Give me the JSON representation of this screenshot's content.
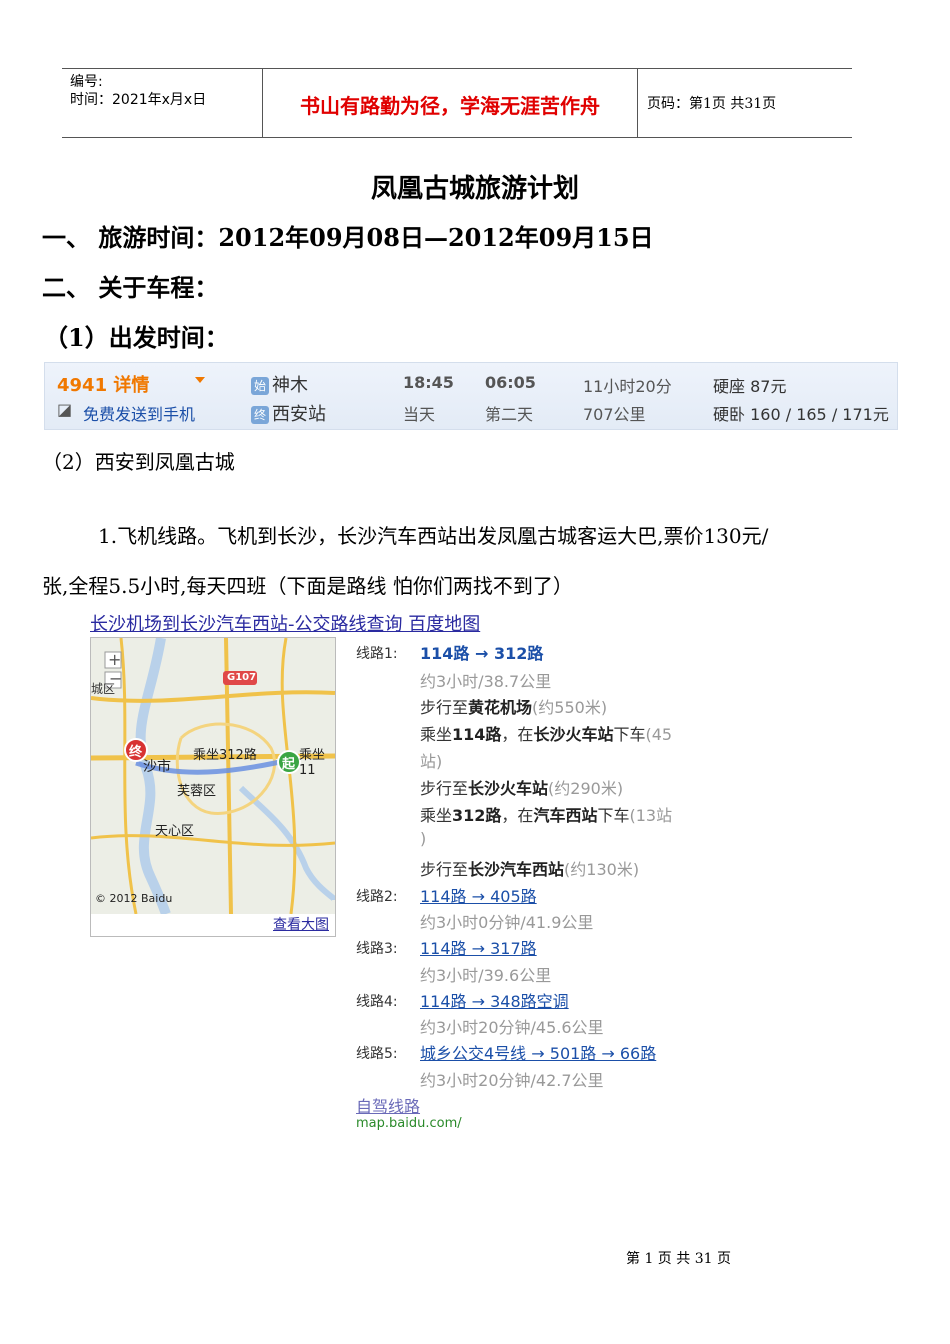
{
  "header": {
    "number_label": "编号:",
    "time_label": "时间：2021年x月x日",
    "motto": "书山有路勤为径，学海无涯苦作舟",
    "page_info": "页码：第1页  共31页"
  },
  "doc": {
    "title": "凤凰古城旅游计划",
    "section1": "一、 旅游时间：2012年09月08日—2012年09月15日",
    "section2": "二、 关于车程：",
    "sub1": "（1）出发时间：",
    "sub2": "（2）西安到凤凰古城",
    "para_line1": "1.飞机线路。飞机到长沙，长沙汽车西站出发凤凰古城客运大巴,票价130元/",
    "para_line2": "张,全程5.5小时,每天四班（下面是路线  怕你们两找不到了）"
  },
  "train": {
    "number": "4941 详情",
    "send_phone": "免费发送到手机",
    "from_badge": "始",
    "from_station": "神木",
    "to_badge": "终",
    "to_station": "西安站",
    "depart_time": "18:45",
    "depart_day": "当天",
    "arrive_time": "06:05",
    "arrive_day": "第二天",
    "duration": "11小时20分",
    "distance": "707公里",
    "seat_hard": "硬座 87元",
    "sleeper_hard": "硬卧 160 / 165 / 171元",
    "badge_colors": {
      "from": "#7aa6d8",
      "to": "#7aa6d8"
    }
  },
  "map": {
    "link": "长沙机场到长沙汽车西站-公交路线查询 百度地图",
    "view_large": "查看大图",
    "copyright": "© 2012 Baidu",
    "label_city": "沙市",
    "label_furong": "芙蓉区",
    "label_tianxin": "天心区",
    "label_ride312": "乘坐312路",
    "label_ride114": "乘坐11",
    "label_g107": "G107",
    "label_left": "城区",
    "marker_end": "终",
    "marker_start": "起"
  },
  "routes": {
    "r1_label": "线路1:",
    "r1_title": "114路 → 312路",
    "r1_time": "约3小时/38.7公里",
    "s1_a": "步行至",
    "s1_b": "黄花机场",
    "s1_c": "(约550米)",
    "s2_a": "乘坐",
    "s2_b": "114路",
    "s2_c": "，在",
    "s2_d": "长沙火车站",
    "s2_e": "下车",
    "s2_f": "(45",
    "s2_g": "站)",
    "s3_a": "步行至",
    "s3_b": "长沙火车站",
    "s3_c": "(约290米)",
    "s4_a": "乘坐",
    "s4_b": "312路",
    "s4_c": "，在",
    "s4_d": "汽车西站",
    "s4_e": "下车",
    "s4_f": "(13站",
    "s4_g": ")",
    "s5_a": "步行至",
    "s5_b": "长沙汽车西站",
    "s5_c": "(约130米)",
    "r2_label": "线路2:",
    "r2_title": "114路 → 405路",
    "r2_time": "约3小时0分钟/41.9公里",
    "r3_label": "线路3:",
    "r3_title": "114路 → 317路",
    "r3_time": "约3小时/39.6公里",
    "r4_label": "线路4:",
    "r4_title": "114路 → 348路空调",
    "r4_time": "约3小时20分钟/45.6公里",
    "r5_label": "线路5:",
    "r5_title": "城乡公交4号线 → 501路 → 66路",
    "r5_time": "约3小时20分钟/42.7公里",
    "self_drive": "自驾线路",
    "source_url": "map.baidu.com/"
  },
  "footer": {
    "page": "第 1 页 共 31 页"
  }
}
